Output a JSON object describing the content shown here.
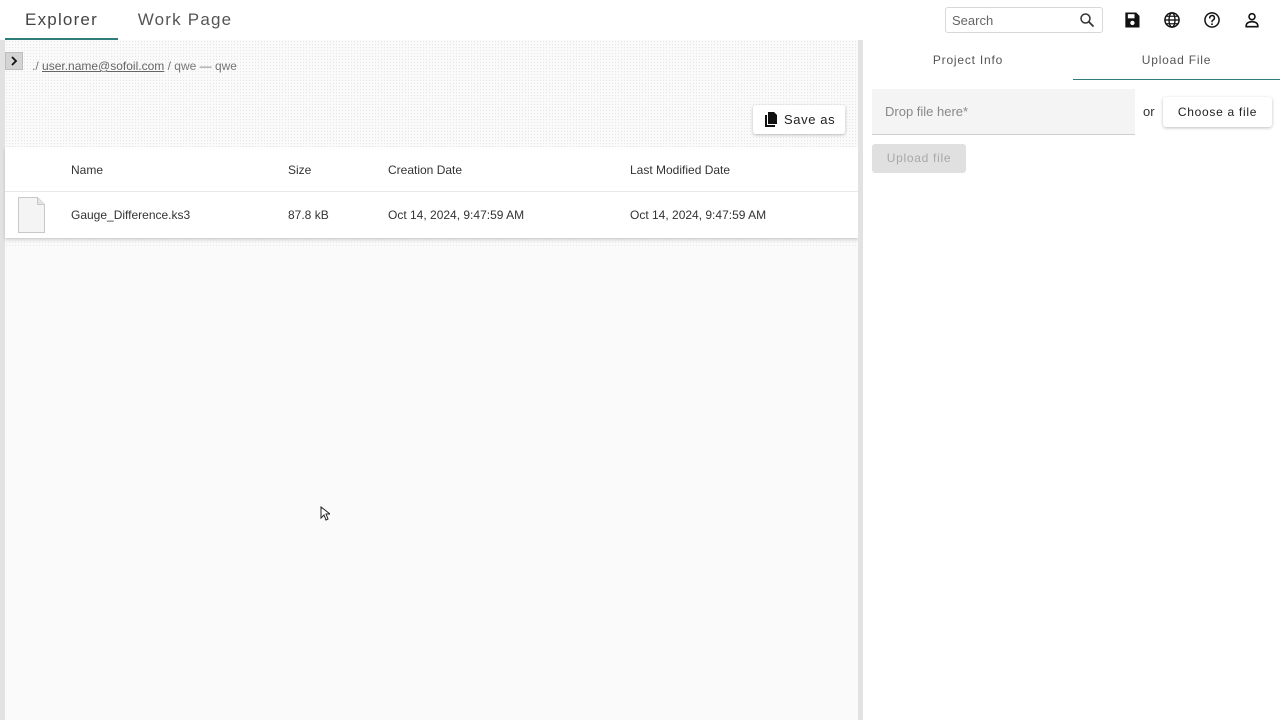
{
  "topbar": {
    "tabs": [
      {
        "label": "Explorer",
        "active": true
      },
      {
        "label": "Work Page",
        "active": false
      }
    ],
    "search": {
      "placeholder": "Search",
      "value": ""
    },
    "icons": [
      "search-icon",
      "save-icon",
      "globe-icon",
      "help-icon",
      "account-icon"
    ]
  },
  "breadcrumb": {
    "root": "./",
    "user": "user.name@sofoil.com",
    "separator": "/",
    "project": "qwe — qwe"
  },
  "toolbar": {
    "save_as_label": "Save as"
  },
  "table": {
    "columns": [
      "Name",
      "Size",
      "Creation Date",
      "Last Modified Date"
    ],
    "rows": [
      {
        "icon": "file-icon",
        "name": "Gauge_Difference.ks3",
        "size": "87.8 kB",
        "created": "Oct 14, 2024, 9:47:59 AM",
        "modified": "Oct 14, 2024, 9:47:59 AM"
      }
    ]
  },
  "right_panel": {
    "tabs": [
      {
        "label": "Project Info",
        "active": false
      },
      {
        "label": "Upload File",
        "active": true
      }
    ],
    "drop_placeholder": "Drop file here*",
    "or_text": "or",
    "choose_label": "Choose a file",
    "upload_label": "Upload file"
  },
  "colors": {
    "accent": "#2e7d7a",
    "panel_bg": "#fafafa",
    "disabled": "#e0e0e0"
  }
}
